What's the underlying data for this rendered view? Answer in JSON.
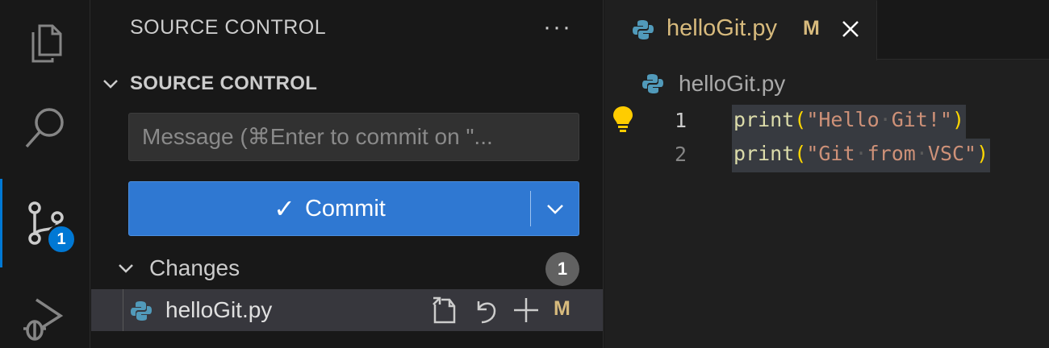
{
  "sidebar": {
    "title": "SOURCE CONTROL",
    "more": "···",
    "section_title": "SOURCE CONTROL",
    "message_placeholder": "Message (⌘Enter to commit on \"...",
    "commit_label": "Commit",
    "commit_check": "✓",
    "changes_label": "Changes",
    "changes_count": "1",
    "file": {
      "name": "helloGit.py",
      "status": "M"
    }
  },
  "activity": {
    "scm_badge": "1"
  },
  "editor": {
    "tab": {
      "name": "helloGit.py",
      "status": "M"
    },
    "breadcrumb": "helloGit.py",
    "lines": [
      {
        "num": "1",
        "fn": "print",
        "open": "(",
        "str_a": "\"Hello",
        "str_b": "Git!\"",
        "close": ")"
      },
      {
        "num": "2",
        "fn": "print",
        "open": "(",
        "str_a": "\"Git",
        "str_b": "from",
        "str_c": "VSC\"",
        "close": ")"
      }
    ]
  },
  "colors": {
    "accent": "#0078d4",
    "modified": "#d7ba7d",
    "commit_button": "#2f78d2"
  }
}
